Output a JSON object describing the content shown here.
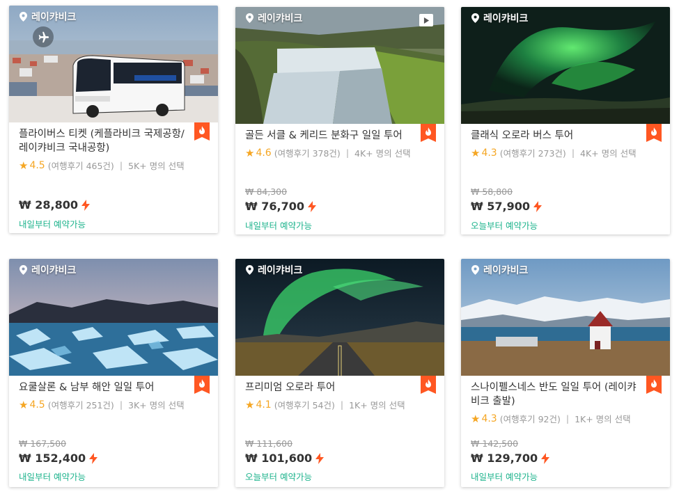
{
  "cards": [
    {
      "location": "레이캬비크",
      "title": "플라이버스 티켓 (케플라비크 국제공항/레이캬비크 국내공항)",
      "score": "4.5",
      "reviews": "(여행후기 465건)",
      "bookings": "5K+ 명의 선택",
      "original_price": "",
      "price": "₩ 28,800",
      "availability": "내일부터 예약가능",
      "image_icon": "plane-icon"
    },
    {
      "location": "레이캬비크",
      "title": "골든 서클 & 케리드 분화구 일일 투어",
      "score": "4.6",
      "reviews": "(여행후기 378건)",
      "bookings": "4K+ 명의 선택",
      "original_price": "₩ 84,300",
      "price": "₩ 76,700",
      "availability": "내일부터 예약가능",
      "image_icon": "play-icon"
    },
    {
      "location": "레이캬비크",
      "title": "클래식 오로라 버스 투어",
      "score": "4.3",
      "reviews": "(여행후기 273건)",
      "bookings": "4K+ 명의 선택",
      "original_price": "₩ 58,800",
      "price": "₩ 57,900",
      "availability": "오늘부터 예약가능"
    },
    {
      "location": "레이캬비크",
      "title": "요쿨살론 & 남부 해안 일일 투어",
      "score": "4.5",
      "reviews": "(여행후기 251건)",
      "bookings": "3K+ 명의 선택",
      "original_price": "₩ 167,500",
      "price": "₩ 152,400",
      "availability": "내일부터 예약가능"
    },
    {
      "location": "레이캬비크",
      "title": "프리미엄 오로라 투어",
      "score": "4.1",
      "reviews": "(여행후기 54건)",
      "bookings": "1K+ 명의 선택",
      "original_price": "₩ 111,600",
      "price": "₩ 101,600",
      "availability": "오늘부터 예약가능"
    },
    {
      "location": "레이캬비크",
      "title": "스나이펠스네스 반도 일일 투어 (레이캬비크 출발)",
      "score": "4.3",
      "reviews": "(여행후기 92건)",
      "bookings": "1K+ 명의 선택",
      "original_price": "₩ 142,500",
      "price": "₩ 129,700",
      "availability": "내일부터 예약가능"
    }
  ],
  "colors": {
    "accent_orange": "#ff5722",
    "star": "#f5a623",
    "availability_green": "#1db38c",
    "muted_text": "#999999"
  }
}
